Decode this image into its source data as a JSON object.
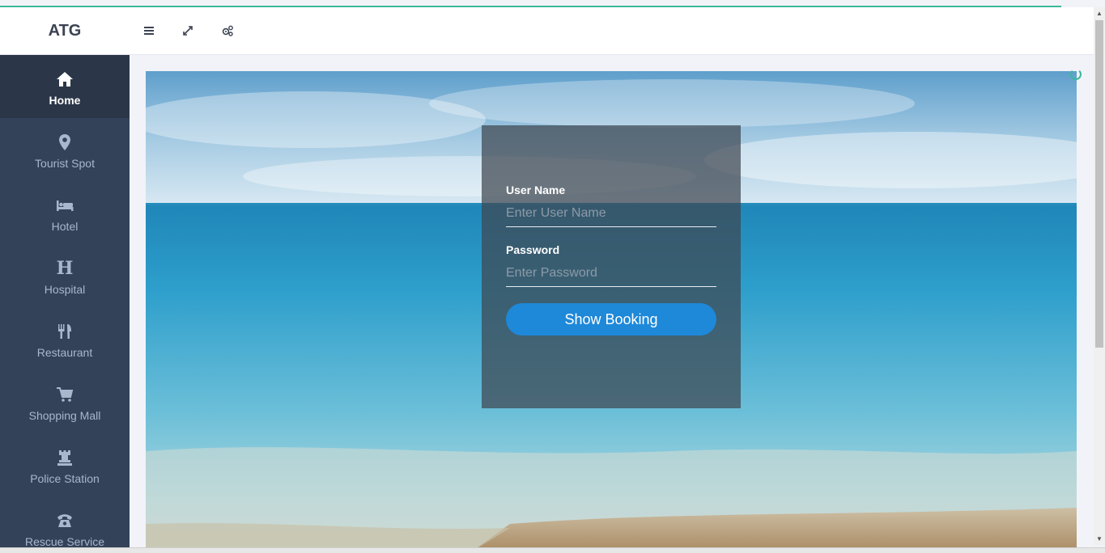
{
  "app": {
    "brand": "ATG"
  },
  "header": {
    "tools": [
      {
        "name": "menu-toggle",
        "icon": "bars-icon"
      },
      {
        "name": "fullscreen",
        "icon": "expand-icon"
      },
      {
        "name": "settings",
        "icon": "cogs-icon"
      }
    ]
  },
  "sidebar": {
    "items": [
      {
        "label": "Home",
        "icon": "home-icon",
        "active": true
      },
      {
        "label": "Tourist Spot",
        "icon": "map-marker-icon"
      },
      {
        "label": "Hotel",
        "icon": "bed-icon"
      },
      {
        "label": "Hospital",
        "icon": "hospital-h-icon",
        "glyph": "H"
      },
      {
        "label": "Restaurant",
        "icon": "cutlery-icon"
      },
      {
        "label": "Shopping Mall",
        "icon": "shopping-cart-icon"
      },
      {
        "label": "Police Station",
        "icon": "rook-icon"
      },
      {
        "label": "Rescue Service",
        "icon": "phone-icon"
      }
    ]
  },
  "login": {
    "username_label": "User Name",
    "username_placeholder": "Enter User Name",
    "password_label": "Password",
    "password_placeholder": "Enter Password",
    "submit_label": "Show Booking"
  },
  "colors": {
    "sidebar_bg": "#334259",
    "sidebar_active_bg": "#2b3749",
    "accent": "#1e88d9",
    "loading_bar": "#3cb89a"
  }
}
